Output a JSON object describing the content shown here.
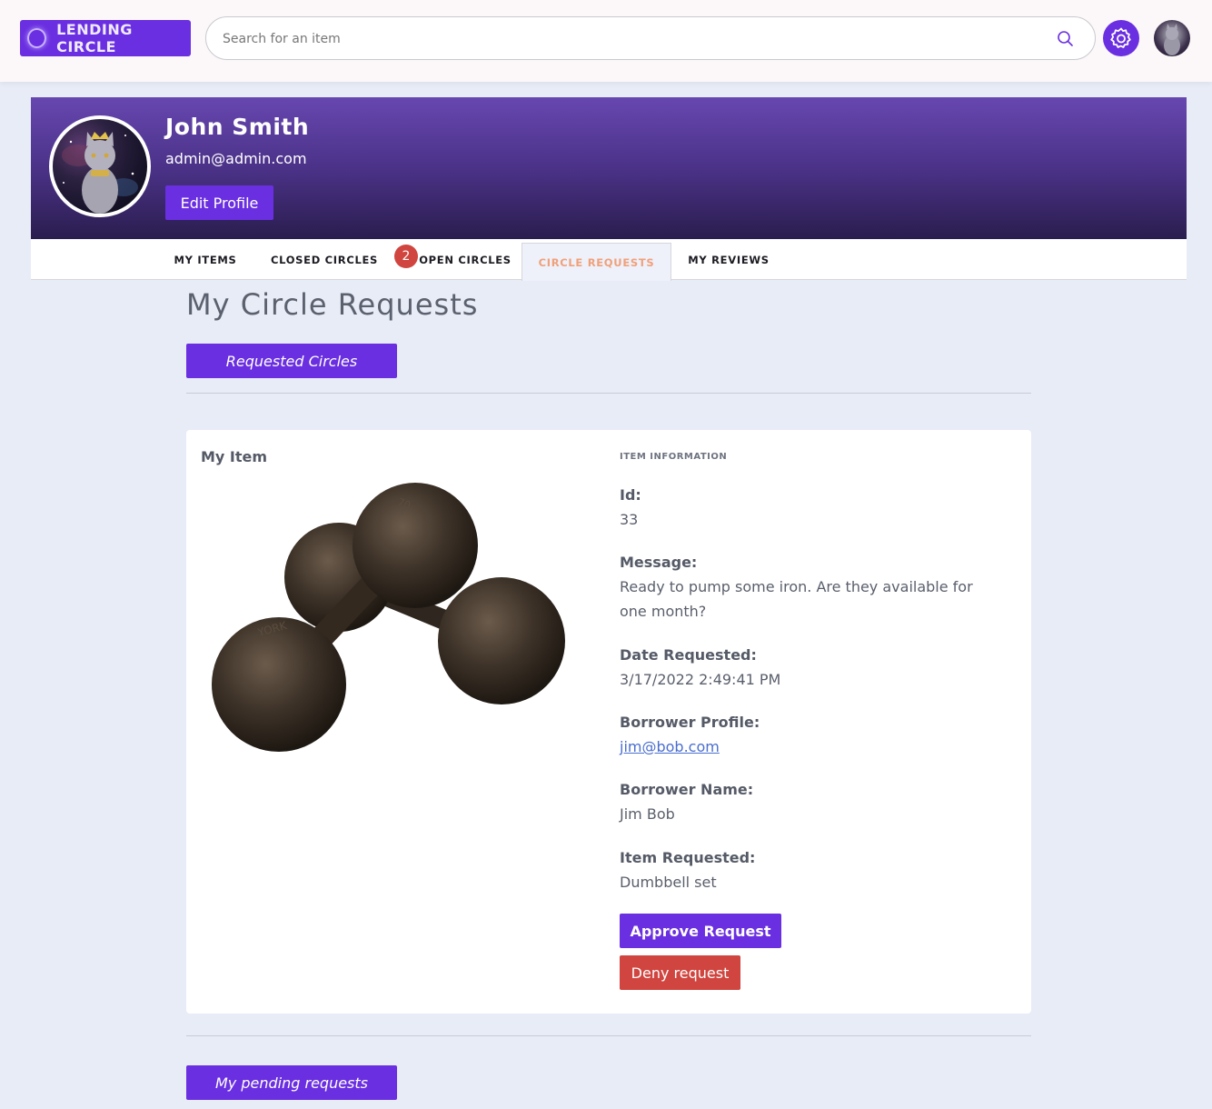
{
  "app": {
    "logo_text": "LENDING CIRCLE",
    "brand_color": "#6a2fe0"
  },
  "search": {
    "placeholder": "Search for an item",
    "icon": "search-icon"
  },
  "nav": {
    "settings_icon": "gear-icon",
    "avatar_icon": "user-avatar"
  },
  "profile": {
    "name": "John Smith",
    "email": "admin@admin.com",
    "edit_label": "Edit Profile"
  },
  "tabs": [
    {
      "label": "MY ITEMS"
    },
    {
      "label": "CLOSED CIRCLES"
    },
    {
      "label": "OPEN CIRCLES",
      "badge": "2"
    },
    {
      "label": "CIRCLE REQUESTS",
      "active": true
    },
    {
      "label": "MY REVIEWS"
    }
  ],
  "main": {
    "title": "My Circle Requests",
    "requested_label": "Requested Circles",
    "pending_label": "My pending requests"
  },
  "request_card": {
    "title": "My Item",
    "info_heading": "ITEM INFORMATION",
    "fields": {
      "id_label": "Id:",
      "id_value": "33",
      "message_label": "Message:",
      "message_value": "Ready to pump some iron. Are they available for one month?",
      "date_label": "Date Requested:",
      "date_value": "3/17/2022 2:49:41 PM",
      "borrower_profile_label": "Borrower Profile:",
      "borrower_profile_value": "jim@bob.com",
      "borrower_name_label": "Borrower Name:",
      "borrower_name_value": "Jim Bob",
      "item_label": "Item Requested:",
      "item_value": "Dumbbell set"
    },
    "approve_label": "Approve Request",
    "deny_label": "Deny request",
    "deny_color": "#d0453f"
  }
}
